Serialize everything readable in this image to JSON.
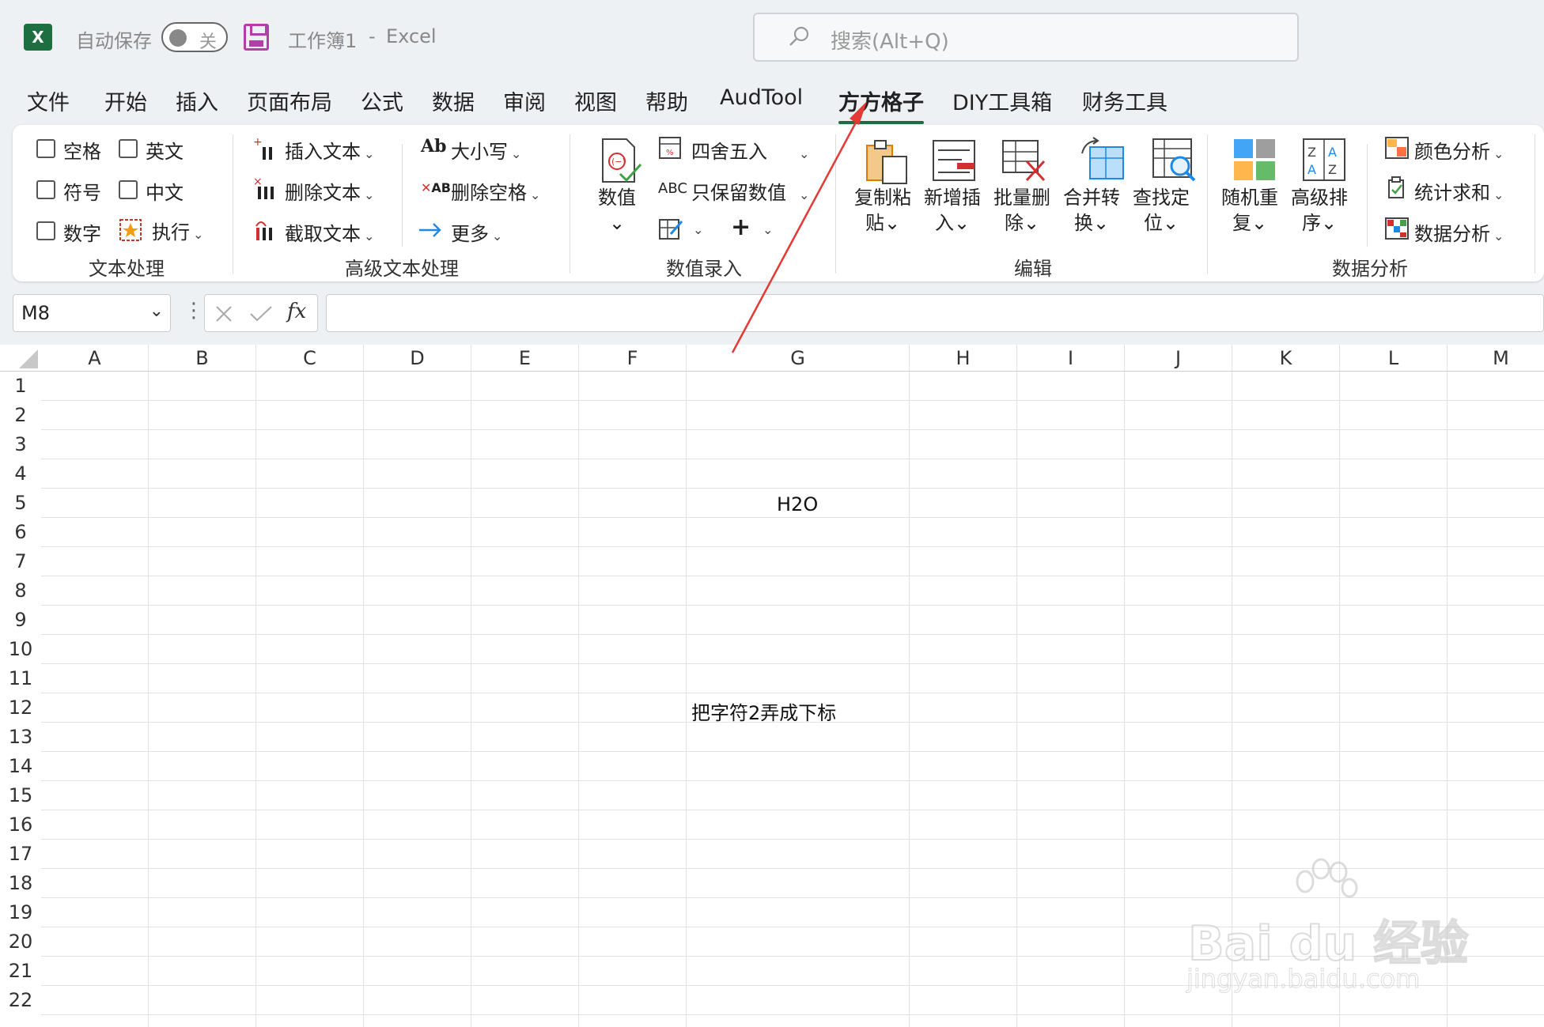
{
  "titlebar": {
    "app_icon": "X",
    "autosave_label": "自动保存",
    "autosave_state": "关",
    "workbook": "工作簿1",
    "separator": "-",
    "app_name": "Excel",
    "search_placeholder": "搜索(Alt+Q)"
  },
  "tabs": [
    "文件",
    "开始",
    "插入",
    "页面布局",
    "公式",
    "数据",
    "审阅",
    "视图",
    "帮助",
    "AudTool",
    "方方格子",
    "DIY工具箱",
    "财务工具"
  ],
  "active_tab": "方方格子",
  "ribbon": {
    "text_processing": {
      "group_label": "文本处理",
      "checkboxes": [
        "空格",
        "英文",
        "符号",
        "中文",
        "数字"
      ],
      "execute": "执行"
    },
    "advanced_text": {
      "group_label": "高级文本处理",
      "insert_text": "插入文本",
      "delete_text": "删除文本",
      "extract_text": "截取文本",
      "case_icon": "Ab",
      "case": "大小写",
      "delete_space_icon": "AB",
      "delete_space": "删除空格",
      "more": "更多"
    },
    "numeric_entry": {
      "group_label": "数值录入",
      "value": "数值",
      "round": "四舍五入",
      "keep_numeric_icon": "ABC",
      "keep_numeric": "只保留数值"
    },
    "edit": {
      "group_label": "编辑",
      "copy_paste": [
        "复制粘",
        "贴"
      ],
      "insert_new": [
        "新增插",
        "入"
      ],
      "batch_delete": [
        "批量删",
        "除"
      ],
      "merge_convert": [
        "合并转",
        "换"
      ],
      "find_locate": [
        "查找定",
        "位"
      ]
    },
    "data_analysis": {
      "group_label": "数据分析",
      "random_repeat": [
        "随机重",
        "复"
      ],
      "advanced_sort": [
        "高级排",
        "序"
      ],
      "color_analysis": "颜色分析",
      "stat_sum": "统计求和",
      "data_analysis": "数据分析"
    }
  },
  "formula_bar": {
    "name_box": "M8",
    "fx": "fx",
    "formula": ""
  },
  "sheet": {
    "columns": [
      "A",
      "B",
      "C",
      "D",
      "E",
      "F",
      "G",
      "H",
      "I",
      "J",
      "K",
      "L",
      "M"
    ],
    "rows": [
      "1",
      "2",
      "3",
      "4",
      "5",
      "6",
      "7",
      "8",
      "9",
      "10",
      "11",
      "12",
      "13",
      "14",
      "15",
      "16",
      "17",
      "18",
      "19",
      "20",
      "21",
      "22"
    ],
    "cell_G5": "H2O",
    "cell_G12": "把字符2弄成下标"
  },
  "watermark": {
    "main": "Bai du 经验",
    "sub": "jingyan.baidu.com"
  },
  "colors": {
    "excel_green": "#1d6f42",
    "annotation_red": "#e53935",
    "save_purple": "#b23fa8"
  }
}
